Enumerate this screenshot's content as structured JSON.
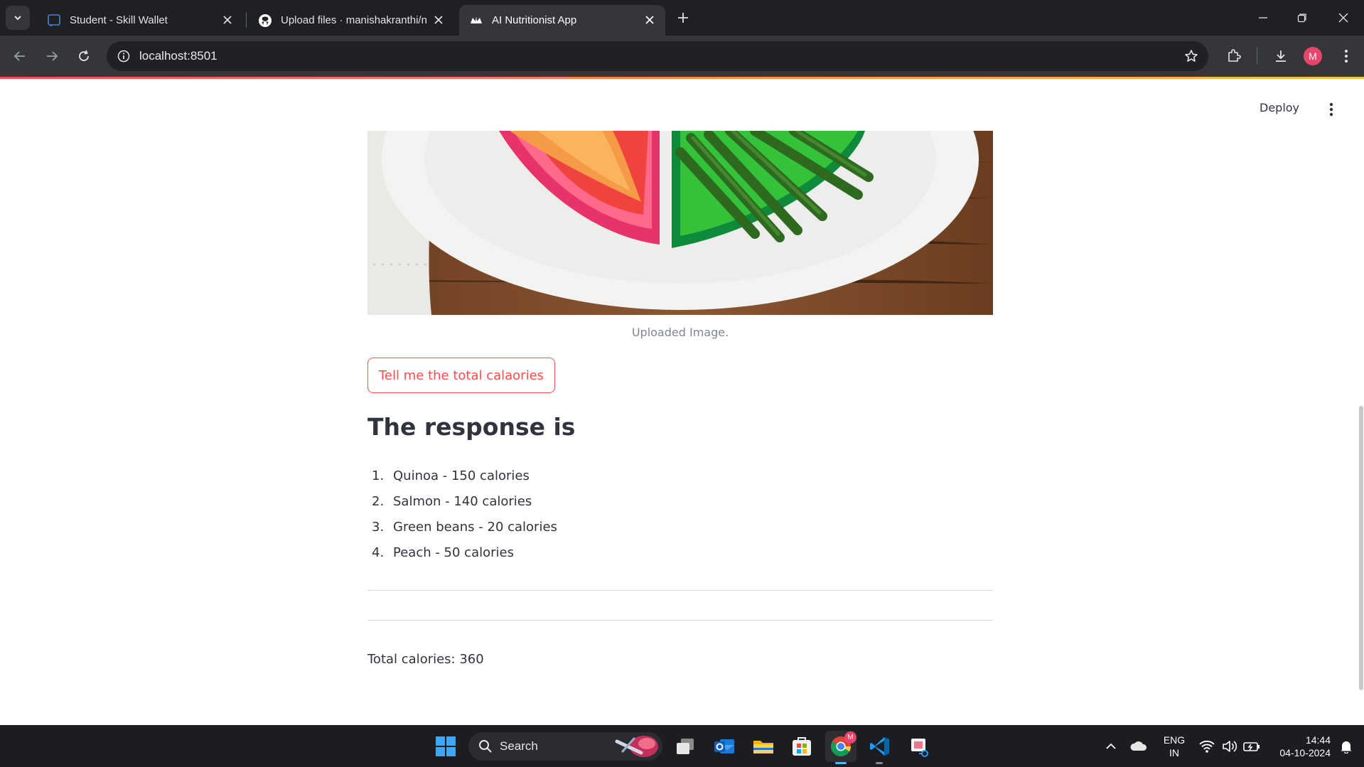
{
  "browser": {
    "tabs": [
      {
        "title": "Student - Skill Wallet",
        "icon": "skill-wallet-icon",
        "active": false
      },
      {
        "title": "Upload files · manishakranthi/n",
        "icon": "github-icon",
        "active": false
      },
      {
        "title": "AI Nutritionist App",
        "icon": "streamlit-icon",
        "active": true
      }
    ],
    "url": "localhost:8501",
    "profile_initial": "M"
  },
  "app": {
    "deploy_label": "Deploy",
    "image_caption": "Uploaded Image.",
    "submit_button": "Tell me the total calaories",
    "response_heading": "The response is",
    "response_items": [
      {
        "num": "1.",
        "text": "Quinoa - 150 calories"
      },
      {
        "num": "2.",
        "text": "Salmon - 140 calories"
      },
      {
        "num": "3.",
        "text": "Green beans - 20 calories"
      },
      {
        "num": "4.",
        "text": "Peach - 50 calories"
      }
    ],
    "total_text": "Total calories: 360",
    "accent_color": "#ff4b4b"
  },
  "taskbar": {
    "search_label": "Search",
    "language_line1": "ENG",
    "language_line2": "IN",
    "time": "14:44",
    "date": "04-10-2024",
    "chrome_badge": "M"
  }
}
